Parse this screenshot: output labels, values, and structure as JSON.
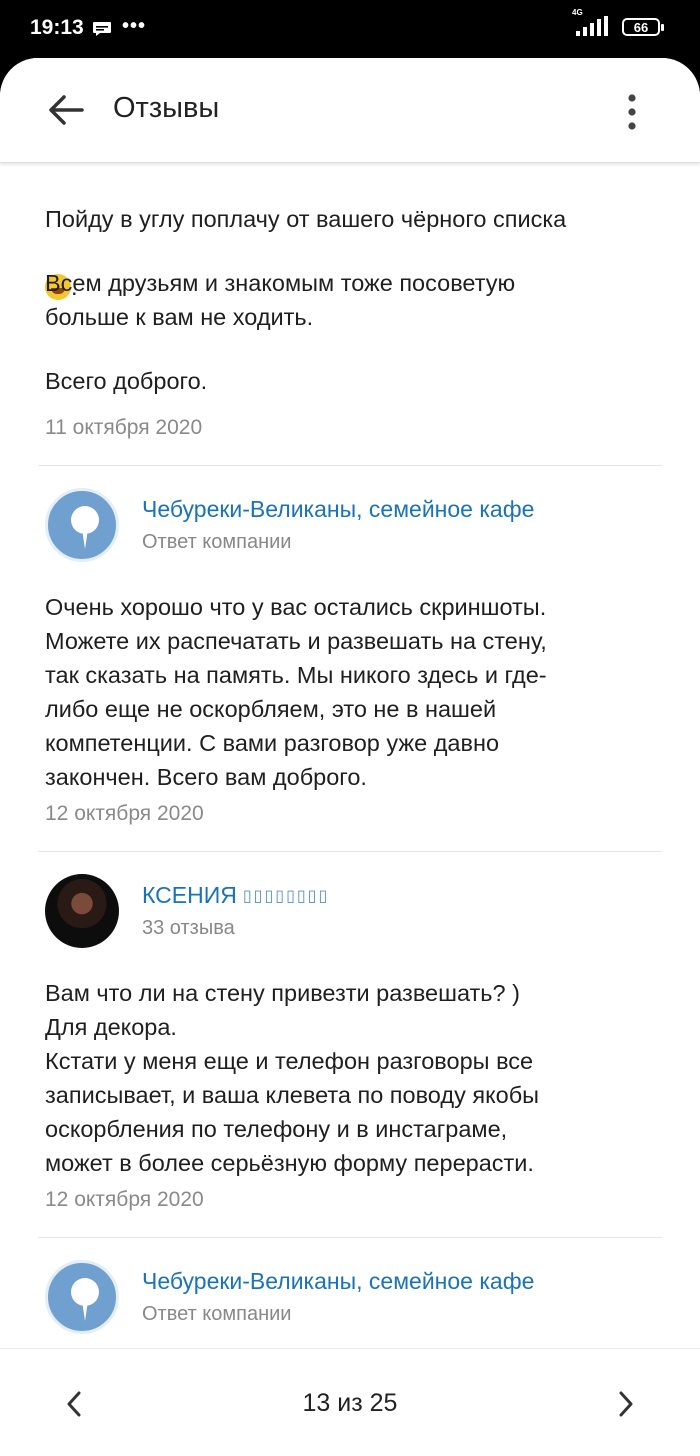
{
  "status": {
    "time": "19:13",
    "network": "4G",
    "battery": "66"
  },
  "header": {
    "title": "Отзывы"
  },
  "review_prev": {
    "line1": "Пойду в углу поплачу от вашего чёрного списка",
    "line1_end": ".",
    "paragraph2": "Всем друзьям и знакомым тоже посоветую\nбольше к вам не ходить.",
    "paragraph3": "Всего доброго.",
    "date": "11 октября 2020"
  },
  "reply1": {
    "author": "Чебуреки-Великаны, семейное кафе",
    "subtitle": "Ответ компании",
    "text": "Очень хорошо что у вас остались скриншоты.\nМожете их распечатать и развешать на стену,\nтак сказать на память. Мы никого здесь и где-\nлибо еще не оскорбляем, это не в нашей\nкомпетенции. С вами разговор уже давно\nзакончен. Всего вам доброго.",
    "date": "12 октября 2020"
  },
  "review2": {
    "author": "КСЕНИЯ",
    "author_suffix": "▯▯▯▯▯▯▯▯",
    "subtitle": "33 отзыва",
    "text": "Вам что ли на стену привезти развешать? )\nДля декора.\nКстати у меня еще и телефон разговоры все\nзаписывает, и ваша клевета по поводу якобы\nоскорбления по телефону и в инстаграме,\nможет в более серьёзную форму перерасти.",
    "date": "12 октября 2020"
  },
  "reply2": {
    "author": "Чебуреки-Великаны, семейное кафе",
    "subtitle": "Ответ компании"
  },
  "pager": {
    "label": "13 из 25"
  },
  "colors": {
    "link": "#1a73b8",
    "company_avatar": "#6fa0d0",
    "date": "#8a8a8a"
  },
  "icons": [
    "back-arrow-icon",
    "more-vert-icon",
    "pin-icon",
    "chevron-left-icon",
    "chevron-right-icon"
  ]
}
